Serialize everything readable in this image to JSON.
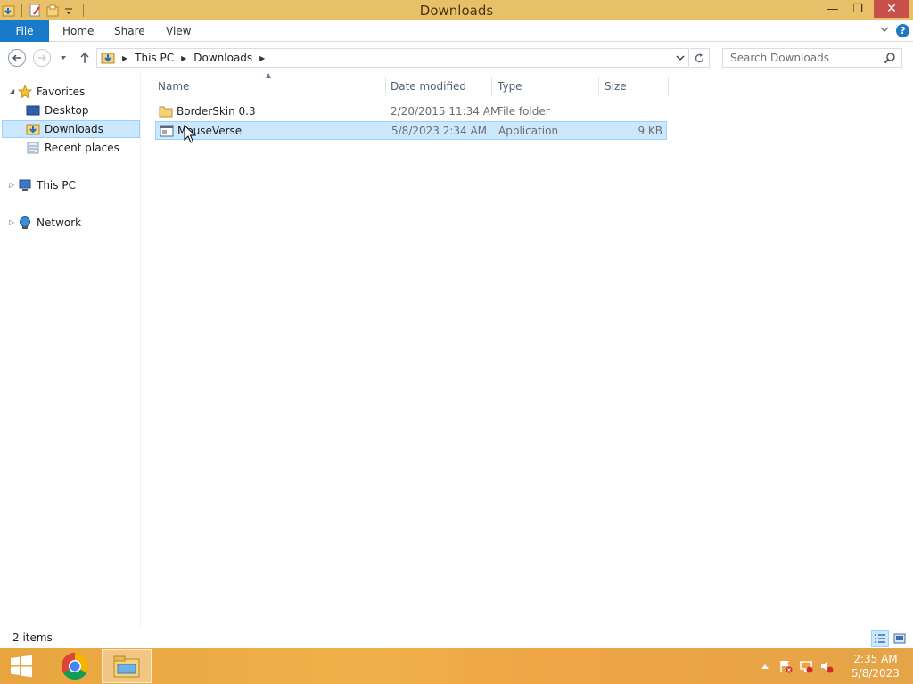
{
  "window": {
    "title": "Downloads",
    "qat_icons": [
      "explorer-app-icon",
      "properties-icon",
      "new-folder-icon",
      "customize-chevron-icon"
    ],
    "min_glyph": "—",
    "restore_glyph": "❐",
    "close_glyph": "✕"
  },
  "ribbon": {
    "tabs": [
      {
        "label": "File"
      },
      {
        "label": "Home"
      },
      {
        "label": "Share"
      },
      {
        "label": "View"
      }
    ],
    "help_glyph": "?"
  },
  "address": {
    "crumbs": [
      "This PC",
      "Downloads"
    ],
    "search_placeholder": "Search Downloads"
  },
  "navpane": {
    "favorites": "Favorites",
    "desktop": "Desktop",
    "downloads": "Downloads",
    "recent_places": "Recent places",
    "this_pc": "This PC",
    "network": "Network"
  },
  "columns": {
    "name": "Name",
    "date_modified": "Date modified",
    "type": "Type",
    "size": "Size"
  },
  "files": [
    {
      "name": "BorderSkin 0.3",
      "date": "2/20/2015 11:34 AM",
      "type": "File folder",
      "size": "",
      "icon": "folder-icon"
    },
    {
      "name": "MouseVerse",
      "date": "5/8/2023 2:34 AM",
      "type": "Application",
      "size": "9 KB",
      "icon": "application-icon",
      "selected": true
    }
  ],
  "status": {
    "item_count": "2 items"
  },
  "taskbar": {
    "clock_time": "2:35 AM",
    "clock_date": "5/8/2023"
  },
  "colors": {
    "titlebar": "#e9c06a",
    "file_tab": "#1979ca",
    "selection": "#cce8ff",
    "selection_border": "#99d1ff",
    "close_button": "#c7504a",
    "taskbar": "#eea545"
  }
}
